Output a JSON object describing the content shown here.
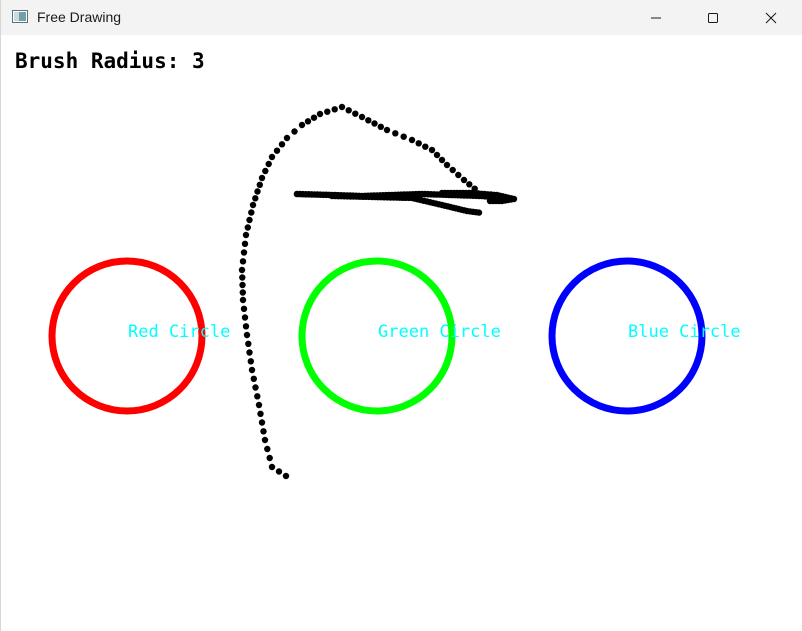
{
  "window": {
    "title": "Free Drawing",
    "icon": "app-window-icon",
    "controls": {
      "minimize_icon": "minimize-icon",
      "maximize_icon": "maximize-icon",
      "close_icon": "close-icon"
    }
  },
  "canvas": {
    "status_text": "Brush Radius: 3",
    "circles": [
      {
        "label": "Red Circle",
        "color": "#ff0000"
      },
      {
        "label": "Green Circle",
        "color": "#00ff00"
      },
      {
        "label": "Blue Circle",
        "color": "#0000ff"
      }
    ],
    "label_color": "#00ffff",
    "stroke_color": "#000000"
  }
}
